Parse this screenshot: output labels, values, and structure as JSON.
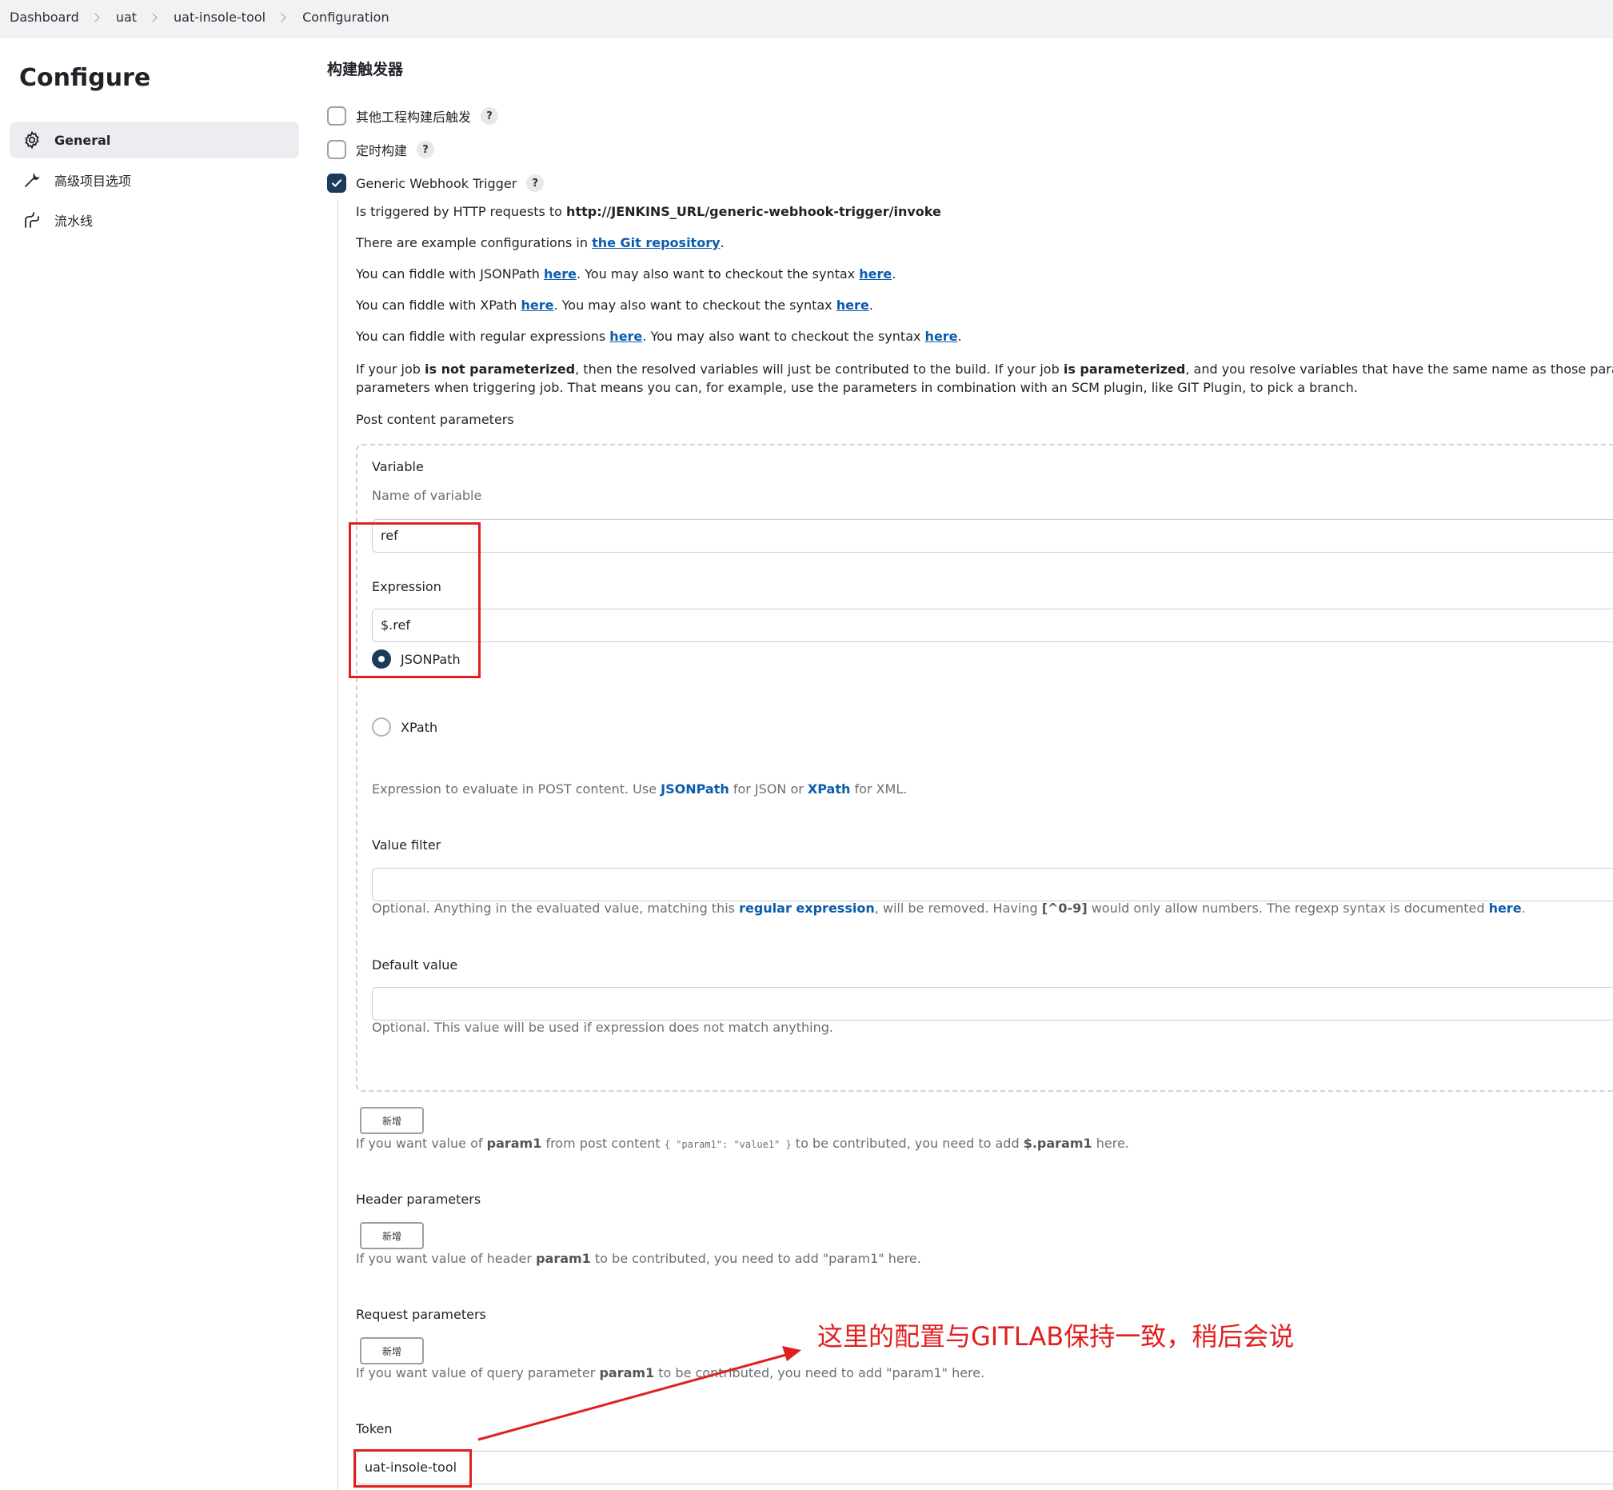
{
  "breadcrumb": [
    "Dashboard",
    "uat",
    "uat-insole-tool",
    "Configuration"
  ],
  "page_title": "Configure",
  "sidebar": {
    "items": [
      {
        "label": "General",
        "icon": "gear-icon",
        "active": true
      },
      {
        "label": "高级项目选项",
        "icon": "wrench-icon",
        "active": false
      },
      {
        "label": "流水线",
        "icon": "pipeline-icon",
        "active": false
      }
    ]
  },
  "section_title": "构建触发器",
  "triggers": [
    {
      "label": "其他工程构建后触发",
      "checked": false
    },
    {
      "label": "定时构建",
      "checked": false
    },
    {
      "label": "Generic Webhook Trigger",
      "checked": true
    }
  ],
  "help_label": "?",
  "webhook": {
    "triggered_text": "Is triggered by HTTP requests to ",
    "invoke_url": "http://JENKINS_URL/generic-webhook-trigger/invoke",
    "example_text": "There are example configurations in ",
    "git_repo_link": "the Git repository",
    "jsonpath_text_1": "You can fiddle with JSONPath ",
    "xpath_text_1": "You can fiddle with XPath ",
    "regex_text_1": "You can fiddle with regular expressions ",
    "here": "here",
    "syntax_text": ". You may also want to checkout the syntax ",
    "param_line1_a": "If your job ",
    "param_line1_b": "is not parameterized",
    "param_line1_c": ", then the resolved variables will just be contributed to the build. If your job ",
    "param_line1_d": "is parameterized",
    "param_line1_e": ", and you resolve variables that have the same name as those parameters, then the",
    "param_line2": "parameters when triggering job. That means you can, for example, use the parameters in combination with an SCM plugin, like GIT Plugin, to pick a branch.",
    "post_content_label": "Post content parameters"
  },
  "post_param": {
    "variable_label": "Variable",
    "variable_hint": "Name of variable",
    "variable_value": "ref",
    "expression_label": "Expression",
    "expression_value": "$.ref",
    "radio_jsonpath": "JSONPath",
    "radio_xpath": "XPath",
    "selected": "JSONPath",
    "expr_hint_a": "Expression to evaluate in POST content. Use ",
    "expr_hint_jsonpath": "JSONPath",
    "expr_hint_b": " for JSON or ",
    "expr_hint_xpath": "XPath",
    "expr_hint_c": " for XML.",
    "value_filter_label": "Value filter",
    "value_filter_value": "",
    "vf_hint_a": "Optional. Anything in the evaluated value, matching this ",
    "vf_hint_regex": "regular expression",
    "vf_hint_b": ", will be removed. Having ",
    "vf_hint_code": "[^0-9]",
    "vf_hint_c": " would only allow numbers. The regexp syntax is documented ",
    "vf_hint_here": "here",
    "default_value_label": "Default value",
    "default_value_value": "",
    "dv_hint": "Optional. This value will be used if expression does not match anything."
  },
  "add_button_label": "新增",
  "post_hint": {
    "a": "If you want value of ",
    "param": "param1",
    "b": " from post content ",
    "code": "{ \"param1\": \"value1\" }",
    "c": " to be contributed, you need to add ",
    "d": "$.param1",
    "e": " here."
  },
  "header_params": {
    "label": "Header parameters",
    "hint_a": "If you want value of header ",
    "hint_param": "param1",
    "hint_b": " to be contributed, you need to add \"param1\" here."
  },
  "request_params": {
    "label": "Request parameters",
    "hint_a": "If you want value of query parameter ",
    "hint_param": "param1",
    "hint_b": " to be contributed, you need to add \"param1\" here."
  },
  "token": {
    "label": "Token",
    "value": "uat-insole-tool"
  },
  "annotation_text": "这里的配置与GITLAB保持一致，稍后会说",
  "colors": {
    "accent_dark": "#1b3a5c",
    "link_blue": "#0b5cad",
    "annotation_red": "#e02020",
    "sidebar_active": "#ededf1"
  }
}
